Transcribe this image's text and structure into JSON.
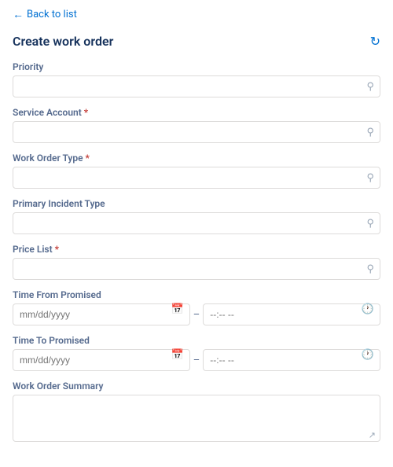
{
  "nav": {
    "back_label": "Back to list"
  },
  "header": {
    "title": "Create work order",
    "refresh_icon": "↻"
  },
  "fields": {
    "priority": {
      "label": "Priority",
      "required": false,
      "placeholder": "",
      "icon": "🔍"
    },
    "service_account": {
      "label": "Service Account",
      "required": true,
      "placeholder": "",
      "icon": "🔍"
    },
    "work_order_type": {
      "label": "Work Order Type",
      "required": true,
      "placeholder": "",
      "icon": "🔍"
    },
    "primary_incident_type": {
      "label": "Primary Incident Type",
      "required": false,
      "placeholder": "",
      "icon": "🔍"
    },
    "price_list": {
      "label": "Price List",
      "required": true,
      "placeholder": "",
      "icon": "🔍"
    },
    "time_from_promised": {
      "label": "Time From Promised",
      "date_placeholder": "mm/dd/yyyy",
      "time_placeholder": "--:-- --"
    },
    "time_to_promised": {
      "label": "Time To Promised",
      "date_placeholder": "mm/dd/yyyy",
      "time_placeholder": "--:-- --"
    },
    "work_order_summary": {
      "label": "Work Order Summary",
      "required": false,
      "placeholder": ""
    }
  },
  "icons": {
    "search": "⚲",
    "calendar": "📅",
    "clock": "🕐",
    "refresh": "↻",
    "back_arrow": "←",
    "expand": "⤢"
  }
}
